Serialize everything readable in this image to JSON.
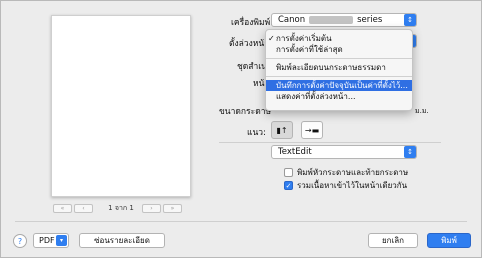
{
  "printer": {
    "label": "เครื่องพิมพ์:",
    "value_prefix": "Canon",
    "value_suffix": "series"
  },
  "presets": {
    "label": "ตั้งล่วงหน้า:"
  },
  "copies": {
    "label": "ชุดสำเนา"
  },
  "pages": {
    "label": "หน้า"
  },
  "paper_size": {
    "label": "ขนาดกระดาษ",
    "unit_partial": "ม.ม."
  },
  "orientation": {
    "label": "แนว:"
  },
  "preset_menu": {
    "items": [
      {
        "label": "การตั้งค่าเริ่มต้น",
        "checked": true
      },
      {
        "label": "การตั้งค่าที่ใช้ล่าสุด",
        "checked": false
      },
      {
        "label": "พิมพ์ละเอียดบนกระดาษธรรมดา",
        "checked": false
      },
      {
        "label": "บันทึกการตั้งค่าปัจจุบันเป็นค่าที่ตั้งไว้...",
        "checked": false,
        "selected": true
      },
      {
        "label": "แสดงค่าที่ตั้งล่วงหน้า...",
        "checked": false
      }
    ]
  },
  "app_section": {
    "value": "TextEdit"
  },
  "options": {
    "header_footer": {
      "label": "พิมพ์หัวกระดาษและท้ายกระดาษ",
      "checked": false
    },
    "rewrap": {
      "label": "รวมเนื้อหาเข้าไว้ในหน้าเดียวกัน",
      "checked": true
    }
  },
  "preview": {
    "page_text": "1 จาก 1"
  },
  "footer": {
    "help": "?",
    "pdf": "PDF",
    "hide_details": "ซ่อนรายละเอียด",
    "cancel": "ยกเลิก",
    "print": "พิมพ์"
  }
}
